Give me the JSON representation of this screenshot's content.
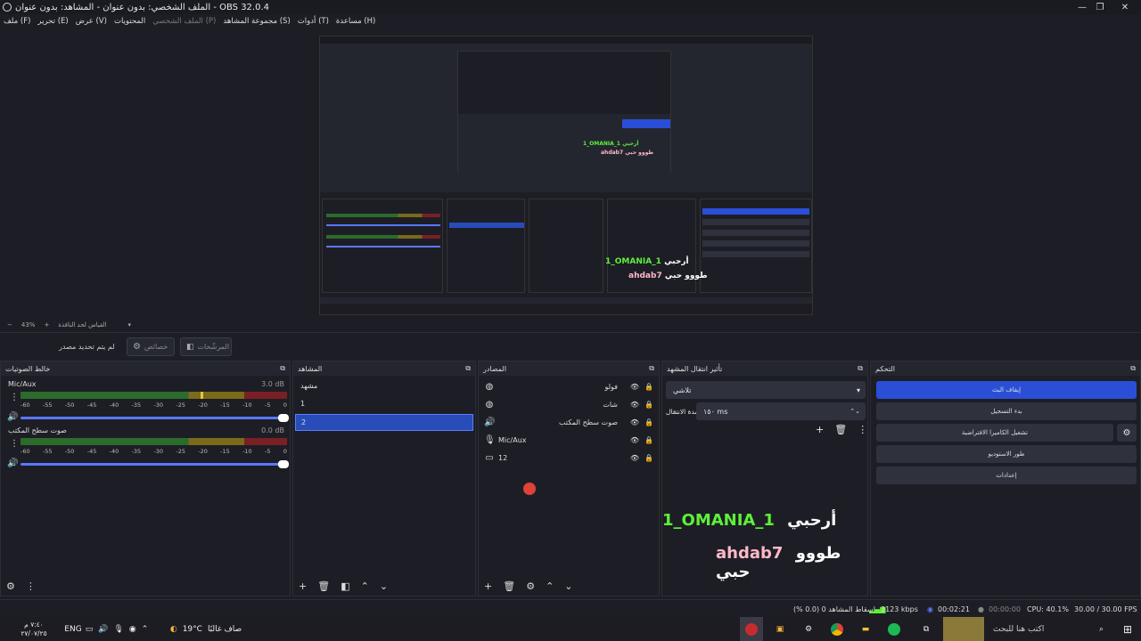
{
  "window": {
    "title": "الملف الشخصي: بدون عنوان - المشاهد: بدون عنوان - OBS 32.0.4",
    "controls": [
      "minimize",
      "maximize",
      "close"
    ]
  },
  "menu": {
    "items": [
      "ملف (F)",
      "تحرير (E)",
      "عرض (V)",
      "المحتويات",
      "الملف الشخصي (P)",
      "مجموعة المشاهد (S)",
      "أدوات (T)",
      "مساعدة (H)"
    ]
  },
  "zoom": {
    "minus": "−",
    "value": "43%",
    "label": "القياس لحد النافذة"
  },
  "toolbar": {
    "no_source": "لم يتم تحديد مصدر",
    "properties": "خصائص",
    "filters": "المرشّحات"
  },
  "mixer": {
    "title": "خالط الصوتيات",
    "channels": [
      {
        "name": "Mic/Aux",
        "db": "3.0 dB",
        "level": 0.69
      },
      {
        "name": "صوت سطح المكتب",
        "db": "0.0 dB",
        "level": 0
      }
    ],
    "ticks": [
      "-60",
      "-55",
      "-50",
      "-45",
      "-40",
      "-35",
      "-30",
      "-25",
      "-20",
      "-15",
      "-10",
      "-5",
      "0"
    ]
  },
  "scenes": {
    "title": "المشاهد",
    "items": [
      "مشهد",
      "1",
      "2"
    ],
    "selected_index": 2
  },
  "sources": {
    "title": "المصادر",
    "items": [
      {
        "label": "فولو",
        "icon": "globe-icon"
      },
      {
        "label": "شات",
        "icon": "globe-icon"
      },
      {
        "label": "صوت سطح المكتب",
        "icon": "speaker-icon"
      },
      {
        "label": "Mic/Aux",
        "icon": "mic-icon"
      },
      {
        "label": "12",
        "icon": "monitor-icon"
      }
    ]
  },
  "transitions": {
    "title": "تأثير انتقال المشهد",
    "selected": "تلاشي",
    "duration_label": "مدة الانتقال",
    "duration_value": "١٥٠ ms"
  },
  "controls": {
    "title": "التحكم",
    "buttons": [
      "إيقاف البث",
      "بدء التسجيل",
      "تشغيل الكاميرا الافتراضية",
      "طور الاستوديو",
      "إعدادات"
    ]
  },
  "overlay": {
    "line1_name": "1_OMANIA_1",
    "line1_text": "أرحبي",
    "line2_name": "ahdab7",
    "line2_text": "طووو حبي"
  },
  "status": {
    "dropped": "إسقاط المشاهد 0 (0.0 %)",
    "bitrate": "3123 kbps",
    "stream_time": "00:02:21",
    "rec_time": "00:00:00",
    "cpu": "CPU: 40.1%",
    "fps": "30.00 / 30.00 FPS"
  },
  "taskbar": {
    "search_placeholder": "اكتب هنا للبحث",
    "weather_text": "صاف غالبًا",
    "temperature": "19°C",
    "language": "ENG",
    "time": "٧:٤٠ م",
    "date": "٢٧/٠٧/٢٥"
  },
  "colors": {
    "accent": "#2a4fd6",
    "selected_scene": "#284cb8",
    "overlay_green": "#5ef03a",
    "overlay_pink": "#ffb8c8",
    "meter_green": "#2b6b2b",
    "meter_yellow": "#7a6a1a",
    "meter_red": "#7a1f25"
  }
}
